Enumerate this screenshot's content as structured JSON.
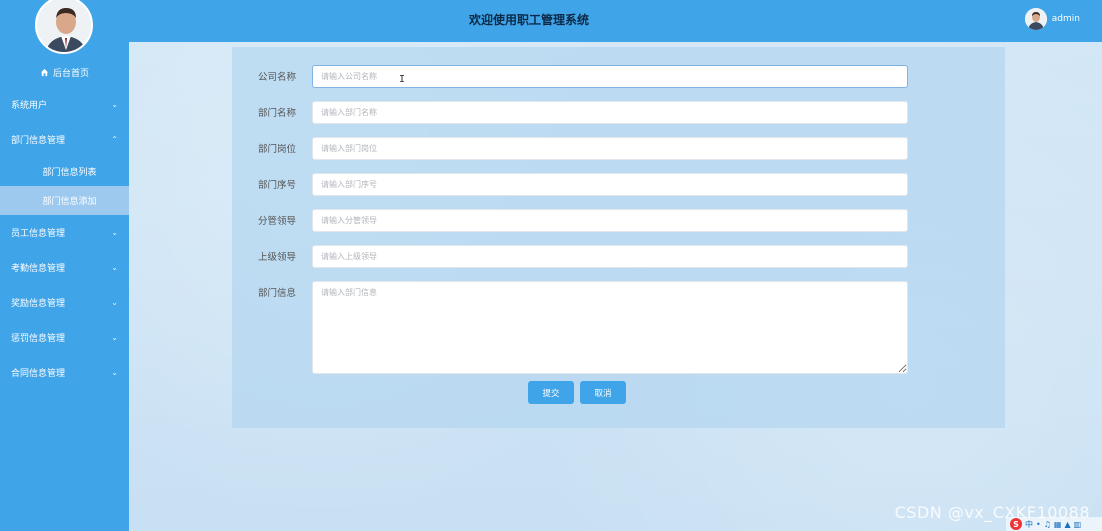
{
  "header": {
    "title": "欢迎使用职工管理系统",
    "username": "admin"
  },
  "sidebar": {
    "home_label": "后台首页",
    "items": [
      {
        "label": "系统用户"
      },
      {
        "label": "部门信息管理",
        "expanded": true
      },
      {
        "label": "员工信息管理"
      },
      {
        "label": "考勤信息管理"
      },
      {
        "label": "奖励信息管理"
      },
      {
        "label": "惩罚信息管理"
      },
      {
        "label": "合同信息管理"
      }
    ],
    "submenu": [
      {
        "label": "部门信息列表"
      },
      {
        "label": "部门信息添加",
        "active": true
      }
    ]
  },
  "form": {
    "fields": [
      {
        "label": "公司名称",
        "placeholder": "请输入公司名称",
        "value": ""
      },
      {
        "label": "部门名称",
        "placeholder": "请输入部门名称",
        "value": ""
      },
      {
        "label": "部门岗位",
        "placeholder": "请输入部门岗位",
        "value": ""
      },
      {
        "label": "部门序号",
        "placeholder": "请输入部门序号",
        "value": ""
      },
      {
        "label": "分管领导",
        "placeholder": "请输入分管领导",
        "value": ""
      },
      {
        "label": "上级领导",
        "placeholder": "请输入上级领导",
        "value": ""
      },
      {
        "label": "部门信息",
        "placeholder": "请输入部门信息",
        "value": ""
      }
    ],
    "submit_label": "提交",
    "cancel_label": "取消"
  },
  "watermark": "CSDN @vx_CXKF10088",
  "tray": {
    "logo": "S",
    "lang": "中"
  },
  "colors": {
    "accent": "#3fa4e8",
    "active_submenu": "#9ec9ee",
    "panel": "#b4d7f0"
  }
}
